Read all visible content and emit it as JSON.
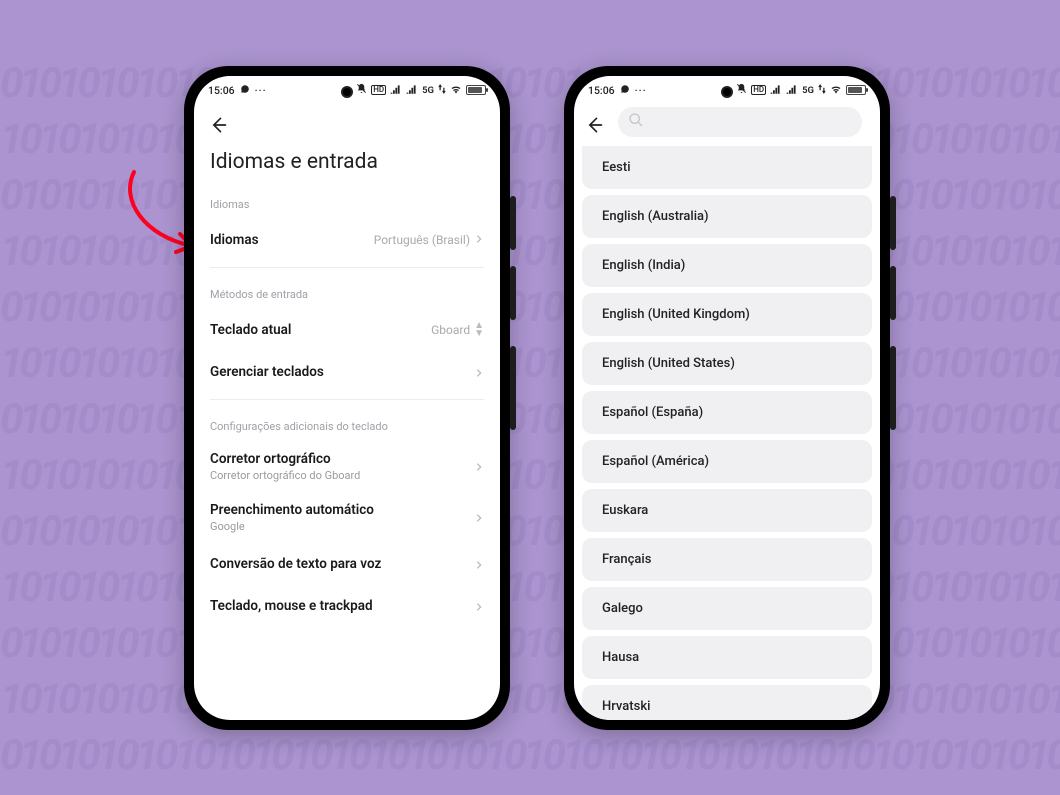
{
  "status": {
    "time": "15:06",
    "network_label": "5G",
    "battery_pct": 84
  },
  "left": {
    "title": "Idiomas e entrada",
    "section_languages": "Idiomas",
    "row_languages_label": "Idiomas",
    "row_languages_value": "Português (Brasil)",
    "section_input": "Métodos de entrada",
    "row_current_kb_label": "Teclado atual",
    "row_current_kb_value": "Gboard",
    "row_manage_kb_label": "Gerenciar teclados",
    "section_additional": "Configurações adicionais do teclado",
    "row_spell_label": "Corretor ortográfico",
    "row_spell_sub": "Corretor ortográfico do Gboard",
    "row_autofill_label": "Preenchimento automático",
    "row_autofill_sub": "Google",
    "row_tts_label": "Conversão de texto para voz",
    "row_peripherals_label": "Teclado, mouse e trackpad"
  },
  "right": {
    "search_placeholder": "",
    "languages": [
      "Eesti",
      "English (Australia)",
      "English (India)",
      "English (United Kingdom)",
      "English (United States)",
      "Español (España)",
      "Español (América)",
      "Euskara",
      "Français",
      "Galego",
      "Hausa",
      "Hrvatski"
    ]
  }
}
